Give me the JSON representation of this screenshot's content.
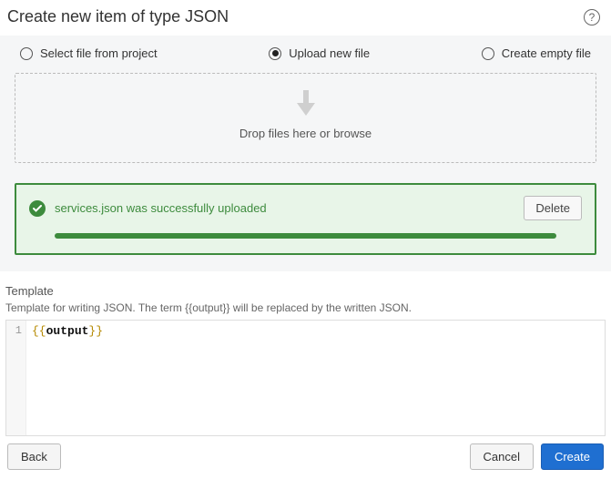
{
  "header": {
    "title": "Create new item of type JSON"
  },
  "options": {
    "select_from_project": "Select file from project",
    "upload_new": "Upload new file",
    "create_empty": "Create empty file",
    "selected": "upload_new"
  },
  "dropzone": {
    "text": "Drop files here or browse"
  },
  "upload": {
    "success_message": "services.json was successfully uploaded",
    "delete_label": "Delete"
  },
  "template": {
    "label": "Template",
    "description": "Template for writing JSON. The term {{output}} will be replaced by the written JSON.",
    "line_number": "1",
    "brace_open": "{{",
    "identifier": "output",
    "brace_close": "}}"
  },
  "footer": {
    "back": "Back",
    "cancel": "Cancel",
    "create": "Create"
  }
}
